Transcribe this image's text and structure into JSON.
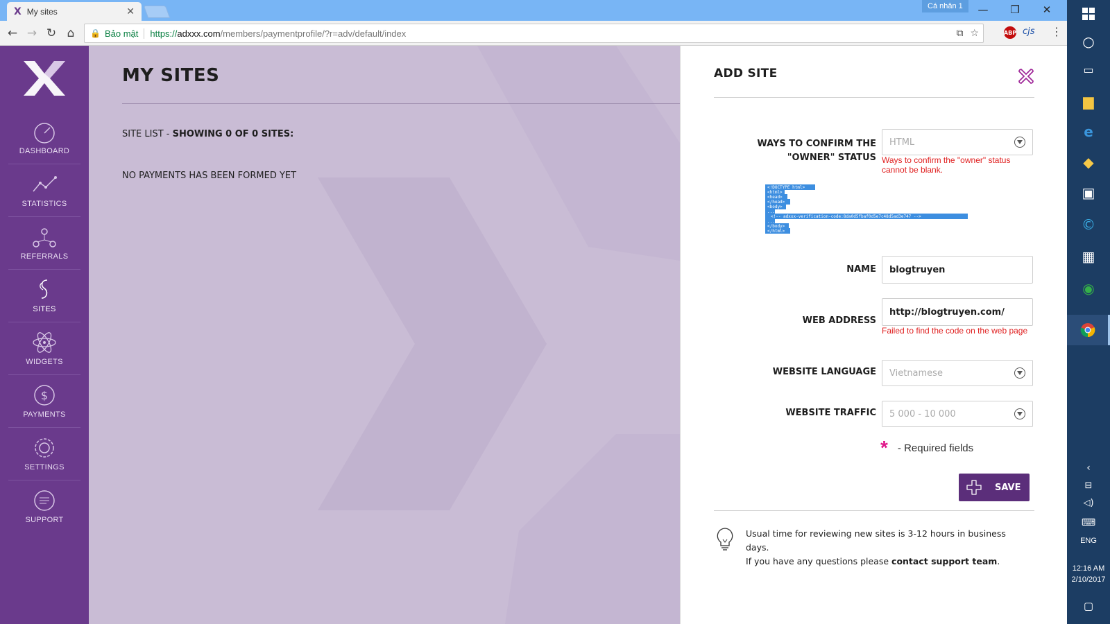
{
  "browser": {
    "tab_title": "My sites",
    "tab_favicon": "X",
    "profile_label": "Cá nhân 1",
    "secure_label": "Bảo mật",
    "url_scheme": "https://",
    "url_host": "adxxx.com",
    "url_path": "/members/paymentprofile/?r=adv/default/index",
    "ext_abp": "ABP",
    "ext_cjs": "cjs"
  },
  "taskbar": {
    "language": "ENG",
    "time": "12:16 AM",
    "date": "2/10/2017"
  },
  "sidebar": {
    "items": [
      {
        "label": "DASHBOARD",
        "icon": "dashboard-icon"
      },
      {
        "label": "STATISTICS",
        "icon": "statistics-icon"
      },
      {
        "label": "REFERRALS",
        "icon": "referrals-icon"
      },
      {
        "label": "SITES",
        "icon": "sites-icon"
      },
      {
        "label": "WIDGETS",
        "icon": "widgets-icon"
      },
      {
        "label": "PAYMENTS",
        "icon": "payments-icon"
      },
      {
        "label": "SETTINGS",
        "icon": "settings-icon"
      },
      {
        "label": "SUPPORT",
        "icon": "support-icon"
      }
    ],
    "active": "SITES"
  },
  "main": {
    "title": "MY SITES",
    "site_list_prefix": "SITE LIST - ",
    "site_list_count": "SHOWING 0 OF 0 SITES:",
    "no_payments": "NO PAYMENTS HAS BEEN FORMED YET"
  },
  "panel": {
    "title": "ADD SITE",
    "ways_label": "WAYS TO CONFIRM THE \"OWNER\" STATUS",
    "ways_placeholder": "HTML",
    "ways_error": "Ways to confirm the \"owner\" status cannot be blank.",
    "code_lines": [
      "<!DOCTYPE html>",
      "<html>",
      "<head>",
      "</head>",
      "<body>",
      "...",
      "<!-- adxxx-verification-code:8da0d5fbaf0d5e7c48d5ad3e747 -->",
      "...",
      "</body>",
      "</html>"
    ],
    "name_label": "NAME",
    "name_value": "blogtruyen",
    "web_label": "WEB ADDRESS",
    "web_value": "http://blogtruyen.com/",
    "web_error": "Failed to find the code on the web page",
    "lang_label": "WEBSITE LANGUAGE",
    "lang_placeholder": "Vietnamese",
    "traffic_label": "WEBSITE TRAFFIC",
    "traffic_placeholder": "5 000 - 10 000",
    "required_star": "*",
    "required_text": "- Required fields",
    "save_label": "SAVE",
    "info_line1": "Usual time for reviewing new sites is 3-12 hours in business days.",
    "info_line2": "If you have any questions please ",
    "info_link": "contact support team",
    "info_end": "."
  },
  "colors": {
    "sidebar": "#6a3a8c",
    "main_bg": "#c9bcd5",
    "accent": "#5b2e7a",
    "error": "#e02020",
    "required": "#e0198a",
    "taskbar": "#1c3d63"
  }
}
